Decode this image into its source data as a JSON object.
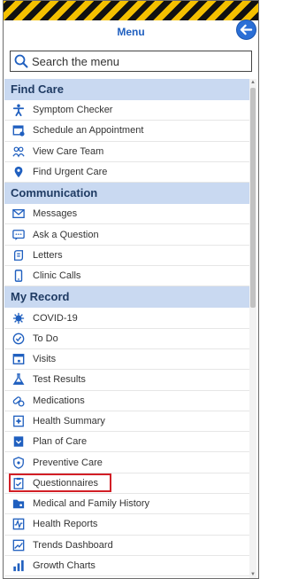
{
  "header": {
    "title": "Menu"
  },
  "search": {
    "placeholder": "Search the menu"
  },
  "sections": {
    "find_care": {
      "label": "Find Care",
      "items": [
        "Symptom Checker",
        "Schedule an Appointment",
        "View Care Team",
        "Find Urgent Care"
      ]
    },
    "communication": {
      "label": "Communication",
      "items": [
        "Messages",
        "Ask a Question",
        "Letters",
        "Clinic Calls"
      ]
    },
    "my_record": {
      "label": "My Record",
      "items": [
        "COVID-19",
        "To Do",
        "Visits",
        "Test Results",
        "Medications",
        "Health Summary",
        "Plan of Care",
        "Preventive Care",
        "Questionnaires",
        "Medical and Family History",
        "Health Reports",
        "Trends Dashboard",
        "Growth Charts"
      ]
    }
  },
  "icons": {
    "find_care": [
      "accessibility-icon",
      "calendar-icon",
      "care-team-icon",
      "location-pin-icon"
    ],
    "communication": [
      "envelope-icon",
      "chat-question-icon",
      "letter-icon",
      "phone-icon"
    ],
    "my_record": [
      "virus-icon",
      "checkmark-circle-icon",
      "visits-icon",
      "flask-icon",
      "pills-icon",
      "health-summary-icon",
      "plan-of-care-icon",
      "shield-icon",
      "clipboard-check-icon",
      "folder-icon",
      "chart-icon",
      "trend-line-icon",
      "growth-chart-icon"
    ]
  },
  "colors": {
    "accent": "#2b6fd6",
    "section_bg": "#c9d9f1",
    "highlight": "#d21f26"
  }
}
